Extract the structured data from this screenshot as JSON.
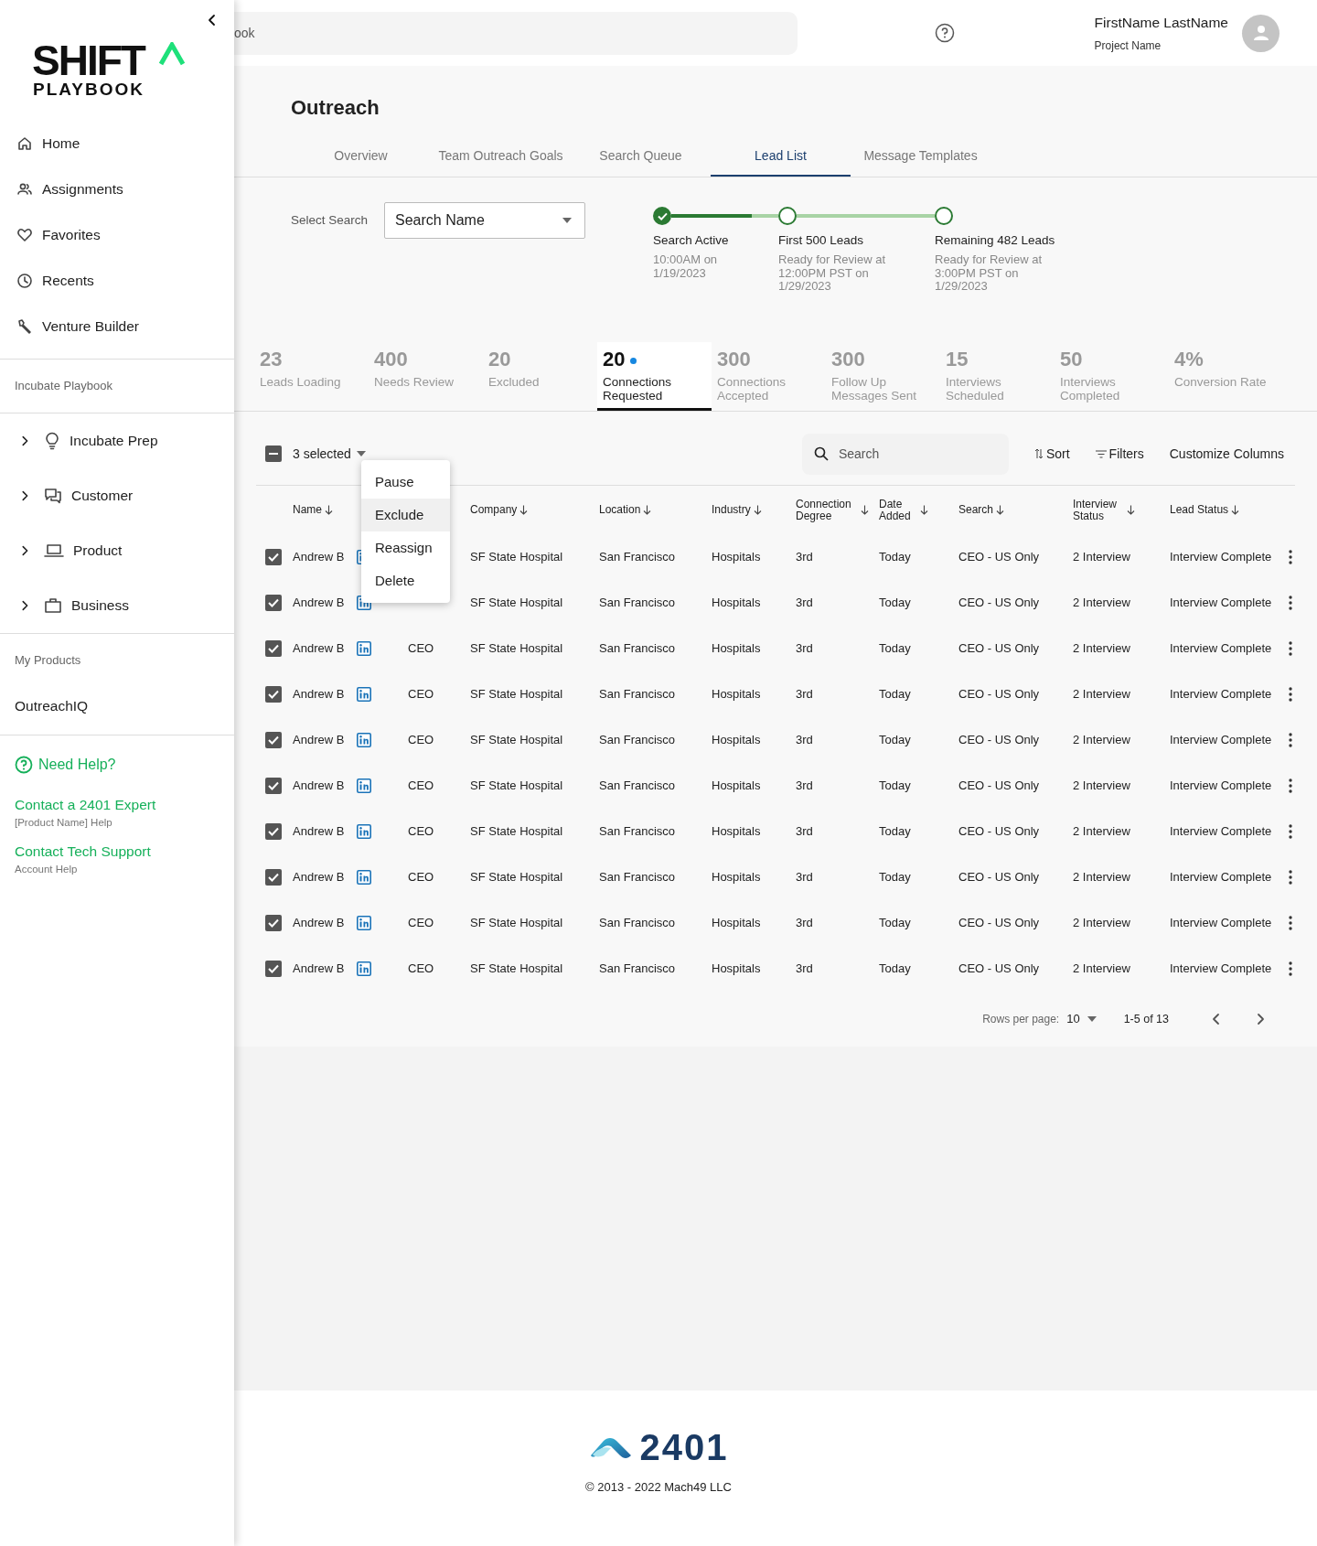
{
  "header": {
    "search_placeholder": "ook",
    "user_name": "FirstName LastName",
    "project": "Project Name"
  },
  "sidebar": {
    "logo": {
      "line1": "SHIFT",
      "line2": "PLAYBOOK"
    },
    "nav": [
      {
        "label": "Home",
        "kind": "home"
      },
      {
        "label": "Assignments",
        "kind": "people"
      },
      {
        "label": "Favorites",
        "kind": "heart"
      },
      {
        "label": "Recents",
        "kind": "clock"
      },
      {
        "label": "Venture Builder",
        "kind": "wrench"
      }
    ],
    "section": "Incubate Playbook",
    "playbook": [
      {
        "label": "Incubate Prep",
        "kind": "bulb",
        "expanded": false
      },
      {
        "label": "Customer",
        "kind": "chat",
        "expanded": false
      },
      {
        "label": "Product",
        "kind": "laptop",
        "expanded": false
      },
      {
        "label": "Business",
        "kind": "briefcase",
        "expanded": false
      }
    ],
    "products_heading": "My Products",
    "products": [
      {
        "label": "OutreachIQ"
      }
    ],
    "help": {
      "title": "Need Help?",
      "links": [
        {
          "label": "Contact a 2401 Expert",
          "sub": "[Product Name] Help"
        },
        {
          "label": "Contact Tech Support",
          "sub": "Account Help"
        }
      ]
    }
  },
  "page": {
    "title": "Outreach",
    "tabs": [
      {
        "label": "Overview",
        "selected": false
      },
      {
        "label": "Team Outreach Goals",
        "selected": false
      },
      {
        "label": "Search Queue",
        "selected": false
      },
      {
        "label": "Lead List",
        "selected": true
      },
      {
        "label": "Message Templates",
        "selected": false
      }
    ]
  },
  "select_search": {
    "label": "Select Search",
    "value": "Search Name"
  },
  "steps": [
    {
      "title": "Search Active",
      "detail": "10:00AM on 1/19/2023",
      "done": true,
      "level": 0.75
    },
    {
      "title": "First 500 Leads",
      "detail": "Ready for Review at 12:00PM PST on 1/29/2023",
      "done": false
    },
    {
      "title": "Remaining 482 Leads",
      "detail": "Ready for Review at 3:00PM PST on 1/29/2023",
      "done": false
    }
  ],
  "stats": [
    {
      "value": "23",
      "label": "Leads Loading",
      "selected": false,
      "indicator": false
    },
    {
      "value": "400",
      "label": "Needs Review",
      "selected": false,
      "indicator": false
    },
    {
      "value": "20",
      "label": "Excluded",
      "selected": false,
      "indicator": false
    },
    {
      "value": "20",
      "label": "Connections Requested",
      "selected": true,
      "indicator": true
    },
    {
      "value": "300",
      "label": "Connections Accepted",
      "selected": false,
      "indicator": false
    },
    {
      "value": "300",
      "label": "Follow Up Messages Sent",
      "selected": false,
      "indicator": false
    },
    {
      "value": "15",
      "label": "Interviews Scheduled",
      "selected": false,
      "indicator": false
    },
    {
      "value": "50",
      "label": "Interviews Completed",
      "selected": false,
      "indicator": false
    },
    {
      "value": "4%",
      "label": "Conversion Rate",
      "selected": false,
      "indicator": false
    }
  ],
  "table": {
    "indeterminate": true,
    "selection": "3 selected",
    "search_placeholder": "Search",
    "actions": [
      {
        "label": "Sort",
        "kind": "sort"
      },
      {
        "label": "Filters",
        "kind": "filter"
      },
      {
        "label": "Customize Columns",
        "kind": "plain"
      }
    ],
    "menu": [
      {
        "label": "Pause",
        "selected": false
      },
      {
        "label": "Exclude",
        "selected": true
      },
      {
        "label": "Reassign",
        "selected": false
      },
      {
        "label": "Delete",
        "selected": false
      }
    ],
    "columns": [
      "Name",
      "Company",
      "Location",
      "Industry",
      "Connection Degree",
      "Date Added",
      "Search",
      "Interview Status",
      "Lead Status"
    ],
    "rows": [
      {
        "checked": true,
        "name": "Andrew B",
        "company": "SF State Hospital",
        "location": "San Francisco",
        "industry": "Hospitals",
        "degree": "3rd",
        "date_added": "Today",
        "search": "CEO - US Only",
        "interview_status": "2 Interview",
        "lead_status": "Interview Complete"
      },
      {
        "checked": true,
        "name": "Andrew B",
        "company": "SF State Hospital",
        "location": "San Francisco",
        "industry": "Hospitals",
        "degree": "3rd",
        "date_added": "Today",
        "search": "CEO - US Only",
        "interview_status": "2 Interview",
        "lead_status": "Interview Complete"
      },
      {
        "checked": true,
        "name": "Andrew B",
        "title": "CEO",
        "company": "SF State Hospital",
        "location": "San Francisco",
        "industry": "Hospitals",
        "degree": "3rd",
        "date_added": "Today",
        "search": "CEO - US Only",
        "interview_status": "2 Interview",
        "lead_status": "Interview Complete"
      },
      {
        "checked": true,
        "name": "Andrew B",
        "title": "CEO",
        "company": "SF State Hospital",
        "location": "San Francisco",
        "industry": "Hospitals",
        "degree": "3rd",
        "date_added": "Today",
        "search": "CEO - US Only",
        "interview_status": "2 Interview",
        "lead_status": "Interview Complete"
      },
      {
        "checked": true,
        "name": "Andrew B",
        "title": "CEO",
        "company": "SF State Hospital",
        "location": "San Francisco",
        "industry": "Hospitals",
        "degree": "3rd",
        "date_added": "Today",
        "search": "CEO - US Only",
        "interview_status": "2 Interview",
        "lead_status": "Interview Complete"
      },
      {
        "checked": true,
        "name": "Andrew B",
        "title": "CEO",
        "company": "SF State Hospital",
        "location": "San Francisco",
        "industry": "Hospitals",
        "degree": "3rd",
        "date_added": "Today",
        "search": "CEO - US Only",
        "interview_status": "2 Interview",
        "lead_status": "Interview Complete"
      },
      {
        "checked": true,
        "name": "Andrew B",
        "title": "CEO",
        "company": "SF State Hospital",
        "location": "San Francisco",
        "industry": "Hospitals",
        "degree": "3rd",
        "date_added": "Today",
        "search": "CEO - US Only",
        "interview_status": "2 Interview",
        "lead_status": "Interview Complete"
      },
      {
        "checked": true,
        "name": "Andrew B",
        "title": "CEO",
        "company": "SF State Hospital",
        "location": "San Francisco",
        "industry": "Hospitals",
        "degree": "3rd",
        "date_added": "Today",
        "search": "CEO - US Only",
        "interview_status": "2 Interview",
        "lead_status": "Interview Complete"
      },
      {
        "checked": true,
        "name": "Andrew B",
        "title": "CEO",
        "company": "SF State Hospital",
        "location": "San Francisco",
        "industry": "Hospitals",
        "degree": "3rd",
        "date_added": "Today",
        "search": "CEO - US Only",
        "interview_status": "2 Interview",
        "lead_status": "Interview Complete"
      },
      {
        "checked": true,
        "name": "Andrew B",
        "title": "CEO",
        "company": "SF State Hospital",
        "location": "San Francisco",
        "industry": "Hospitals",
        "degree": "3rd",
        "date_added": "Today",
        "search": "CEO - US Only",
        "interview_status": "2 Interview",
        "lead_status": "Interview Complete"
      }
    ]
  },
  "pagination": {
    "label": "Rows per page:",
    "per_page": "10",
    "range": "1-5 of 13"
  },
  "footer": {
    "logo": "2401",
    "copyright": "© 2013 - 2022 Mach49 LLC"
  }
}
